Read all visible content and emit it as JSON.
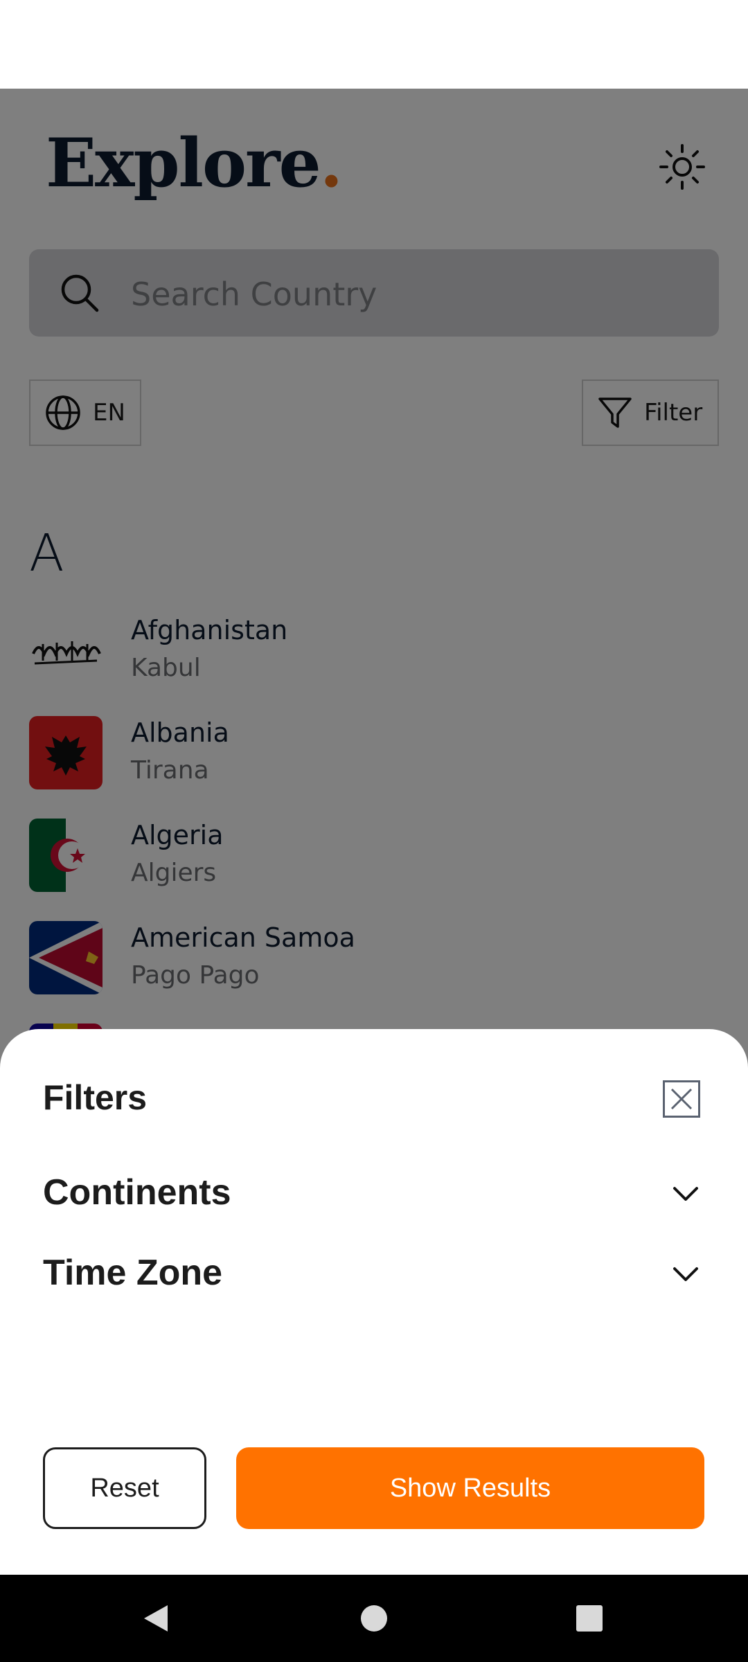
{
  "app": {
    "brand": "Explore",
    "brand_dot": ".",
    "search": {
      "placeholder": "Search Country"
    },
    "language": {
      "label": "EN"
    },
    "filter": {
      "label": "Filter"
    },
    "section_letter": "A",
    "countries": [
      {
        "name": "Afghanistan",
        "capital": "Kabul"
      },
      {
        "name": "Albania",
        "capital": "Tirana"
      },
      {
        "name": "Algeria",
        "capital": "Algiers"
      },
      {
        "name": "American Samoa",
        "capital": "Pago Pago"
      }
    ]
  },
  "filters_sheet": {
    "title": "Filters",
    "sections": [
      {
        "label": "Continents"
      },
      {
        "label": "Time Zone"
      }
    ],
    "reset_label": "Reset",
    "show_results_label": "Show Results"
  },
  "colors": {
    "accent": "#ff7200",
    "brand_dot": "#e8701a",
    "brand_text": "#0d1b2e"
  },
  "icons": [
    "sun-icon",
    "search-icon",
    "globe-icon",
    "funnel-icon",
    "close-icon",
    "chevron-down-icon",
    "back-icon",
    "home-icon",
    "recents-icon"
  ]
}
